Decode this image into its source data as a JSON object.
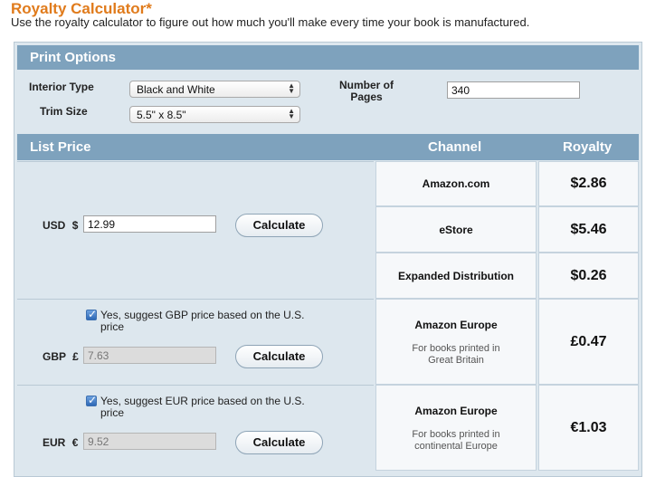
{
  "header": {
    "title": "Royalty Calculator*",
    "subtitle": "Use the royalty calculator to figure out how much you'll make every time your book is manufactured."
  },
  "print_options": {
    "heading": "Print Options",
    "interior_type": {
      "label": "Interior Type",
      "value": "Black and White"
    },
    "trim_size": {
      "label": "Trim Size",
      "value": "5.5\" x 8.5\""
    },
    "pages": {
      "label_line1": "Number of",
      "label_line2": "Pages",
      "value": "340"
    }
  },
  "table_header": {
    "list_price": "List Price",
    "channel": "Channel",
    "royalty": "Royalty"
  },
  "usd": {
    "label": "USD",
    "symbol": "$",
    "value": "12.99",
    "button": "Calculate",
    "channels": [
      {
        "name": "Amazon.com",
        "royalty": "$2.86"
      },
      {
        "name": "eStore",
        "royalty": "$5.46"
      },
      {
        "name": "Expanded Distribution",
        "royalty": "$0.26"
      }
    ]
  },
  "gbp": {
    "suggest_line1": "Yes, suggest GBP price based on the U.S.",
    "suggest_line2": "price",
    "suggest_checked": true,
    "label": "GBP",
    "symbol": "£",
    "value": "7.63",
    "button": "Calculate",
    "channel": "Amazon Europe",
    "note_line1": "For books printed in",
    "note_line2": "Great Britain",
    "royalty": "£0.47"
  },
  "eur": {
    "suggest_line1": "Yes, suggest EUR price based on the U.S.",
    "suggest_line2": "price",
    "suggest_checked": true,
    "label": "EUR",
    "symbol": "€",
    "value": "9.52",
    "button": "Calculate",
    "channel": "Amazon Europe",
    "note_line1": "For books printed in",
    "note_line2": "continental Europe",
    "royalty": "€1.03"
  },
  "colors": {
    "title": "#e07b1c",
    "header_bar": "#7ea2bd",
    "panel": "#dde7ee"
  }
}
